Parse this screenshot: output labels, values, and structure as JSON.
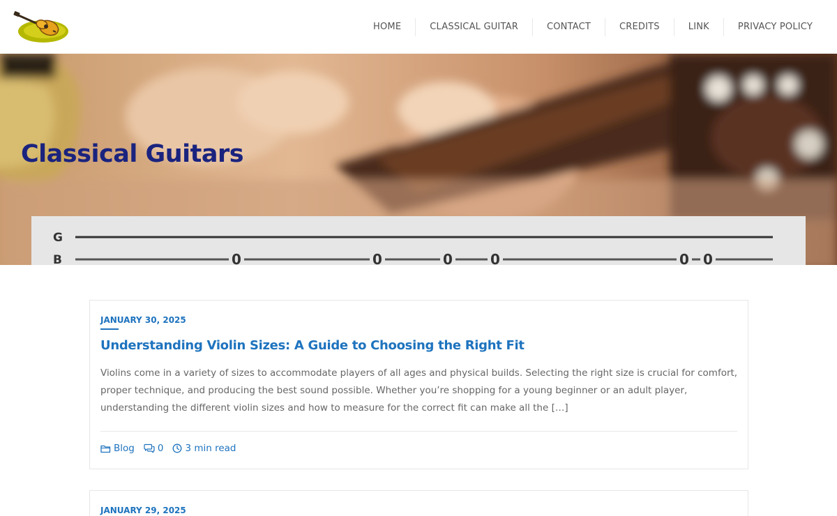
{
  "header": {
    "logo_icon": "guitar-logo-icon",
    "nav": [
      {
        "label": "HOME"
      },
      {
        "label": "CLASSICAL GUITAR"
      },
      {
        "label": "CONTACT"
      },
      {
        "label": "CREDITS"
      },
      {
        "label": "LINK"
      },
      {
        "label": "PRIVACY POLICY"
      }
    ]
  },
  "hero": {
    "title": "Classical Guitars",
    "tab_strings": [
      "G",
      "B"
    ],
    "tab_notes": [
      "0",
      "0",
      "0",
      "0",
      "0",
      "0"
    ]
  },
  "posts": [
    {
      "date": "JANUARY 30, 2025",
      "title": "Understanding Violin Sizes: A Guide to Choosing the Right Fit",
      "excerpt": "Violins come in a variety of sizes to accommodate players of all ages and physical builds. Selecting the right size is crucial for comfort, proper technique, and producing the best sound possible. Whether you’re shopping for a young beginner or an adult player, understanding the different violin sizes and how to measure for the correct fit can make all the […]",
      "category": "Blog",
      "comments": "0",
      "read_time": "3 min read"
    },
    {
      "date": "JANUARY 29, 2025"
    }
  ],
  "colors": {
    "accent": "#1e73be",
    "hero_title": "#1a237e",
    "nav_text": "#555555"
  }
}
